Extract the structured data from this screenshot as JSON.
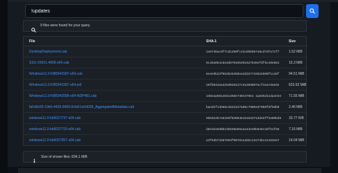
{
  "search": {
    "value": "!updates",
    "button_icon": "search-icon"
  },
  "notice": {
    "icon": "search-icon",
    "text": "9 files were found for your query."
  },
  "table": {
    "headers": {
      "file": "File",
      "sha": "SHA-1",
      "size": "Size"
    },
    "rows": [
      {
        "file": "DesktopDeployment.cab",
        "sha": "1e0735ac6f7c81200fc43c85b05748cd7d7a71f7",
        "size": "1.52 MiB"
      },
      {
        "file": "SSU-22621.4009-x64.cab",
        "sha": "9c45a054c8e2d876165391627646efdf6c49e881",
        "size": "15.3 MiB"
      },
      {
        "file": "Windows11.0-KB5041587-x64.cab",
        "sha": "8e4e9b23f053b2530dea3d157734822500f1cd4f",
        "size": "94.51 MiB"
      },
      {
        "file": "Windows11.0-KB5041587-x64.psf",
        "sha": "29fb043aa425d028127c62359907ecf4a4c9a63e",
        "size": "623.52 MiB"
      },
      {
        "file": "Windows11.0-KB5042099-x64-NDP481.cab",
        "sha": "246eaa6614631458e740447851 1a835d11da4e34",
        "size": "71.55 MiB"
      },
      {
        "file": "fa0d9c69-19b6-4426-8469-0cfa51e0d028_AggregatedMetadata.cab",
        "sha": "baed2f14b68c3842227a05c79004d70b0f8f6db0",
        "size": "2.46 MiB"
      },
      {
        "file": "windows11.0-kb5027737-x64.cab",
        "sha": "955d24b7a5339f83094815163371dd45ff3409bd9",
        "size": "33.77 KiB"
      },
      {
        "file": "windows11.0-kb5037719-x64.cab",
        "sha": "d841b10d0b13b639a55eaa43240b848cebf51f85",
        "size": "7.16 MiB"
      },
      {
        "file": "windows11.0-kb5037957-x64.cab",
        "sha": "a3f5d571b07693f00781a3d2c22274bc21183e67",
        "size": "14.04 MiB"
      }
    ]
  },
  "footer": {
    "icon": "info-icon",
    "text": "Size of shown files: 834,1 MiB"
  },
  "colors": {
    "accent": "#1f6feb",
    "link": "#4493f8",
    "background": "#0d1117"
  }
}
